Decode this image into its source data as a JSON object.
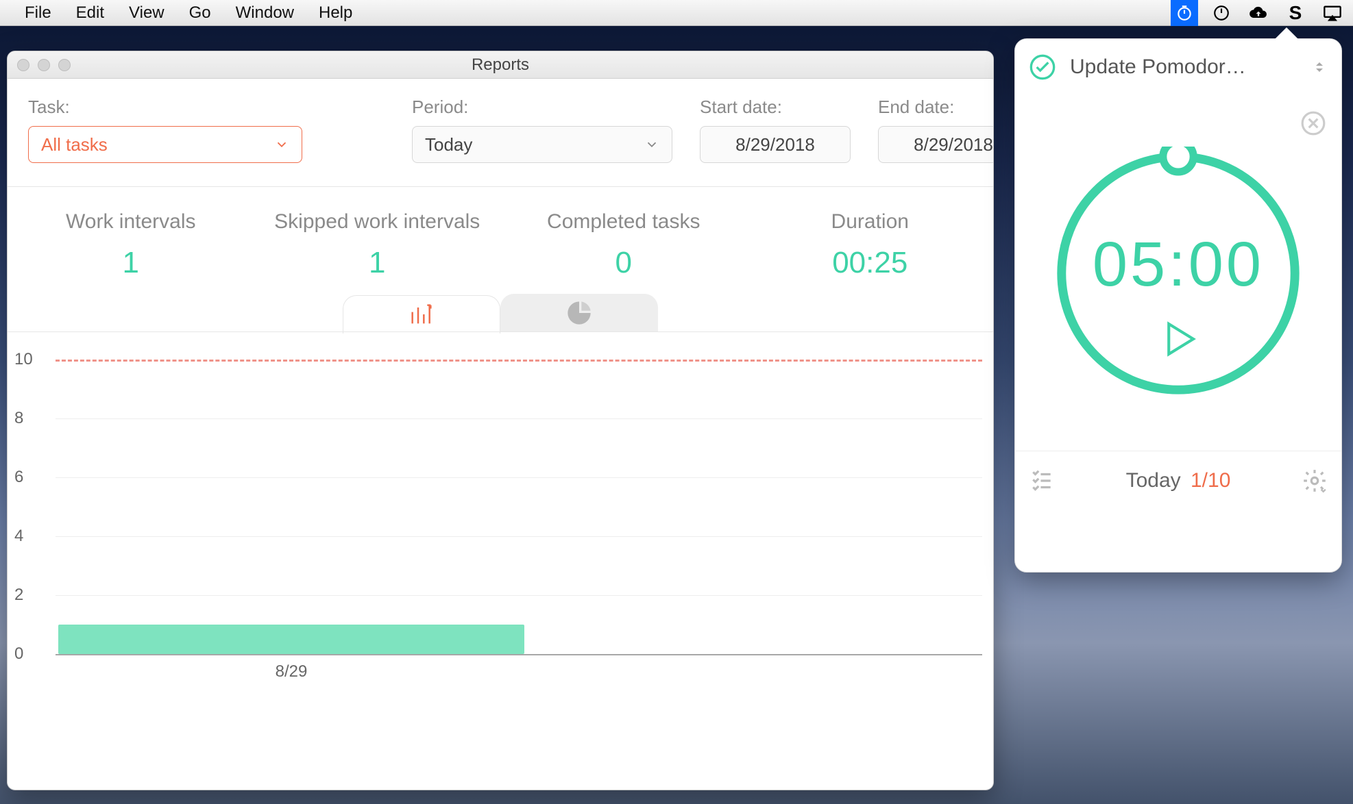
{
  "menubar": {
    "items": [
      "File",
      "Edit",
      "View",
      "Go",
      "Window",
      "Help"
    ],
    "status_icons": [
      "timer-icon",
      "power-icon",
      "cloud-up-icon",
      "s-icon",
      "airplay-icon"
    ]
  },
  "window": {
    "title": "Reports",
    "filters": {
      "task_label": "Task:",
      "task_value": "All tasks",
      "period_label": "Period:",
      "period_value": "Today",
      "start_label": "Start date:",
      "start_value": "8/29/2018",
      "end_label": "End date:",
      "end_value": "8/29/2018"
    },
    "stats": {
      "work_intervals_label": "Work intervals",
      "work_intervals_value": "1",
      "skipped_label": "Skipped work intervals",
      "skipped_value": "1",
      "completed_label": "Completed tasks",
      "completed_value": "0",
      "duration_label": "Duration",
      "duration_value": "00:25"
    }
  },
  "popover": {
    "task_name": "Update Pomodor…",
    "time": "05:00",
    "footer_label": "Today",
    "footer_fraction": "1/10"
  },
  "colors": {
    "accent_green": "#3dd2a6",
    "accent_orange": "#ef6c4a",
    "threshold_red": "#e74c3c"
  },
  "chart_data": {
    "type": "bar",
    "title": "",
    "xlabel": "",
    "ylabel": "",
    "ylim": [
      0,
      10
    ],
    "yticks": [
      0,
      2,
      4,
      6,
      8,
      10
    ],
    "threshold": 10,
    "categories": [
      "8/29"
    ],
    "values": [
      1
    ]
  }
}
